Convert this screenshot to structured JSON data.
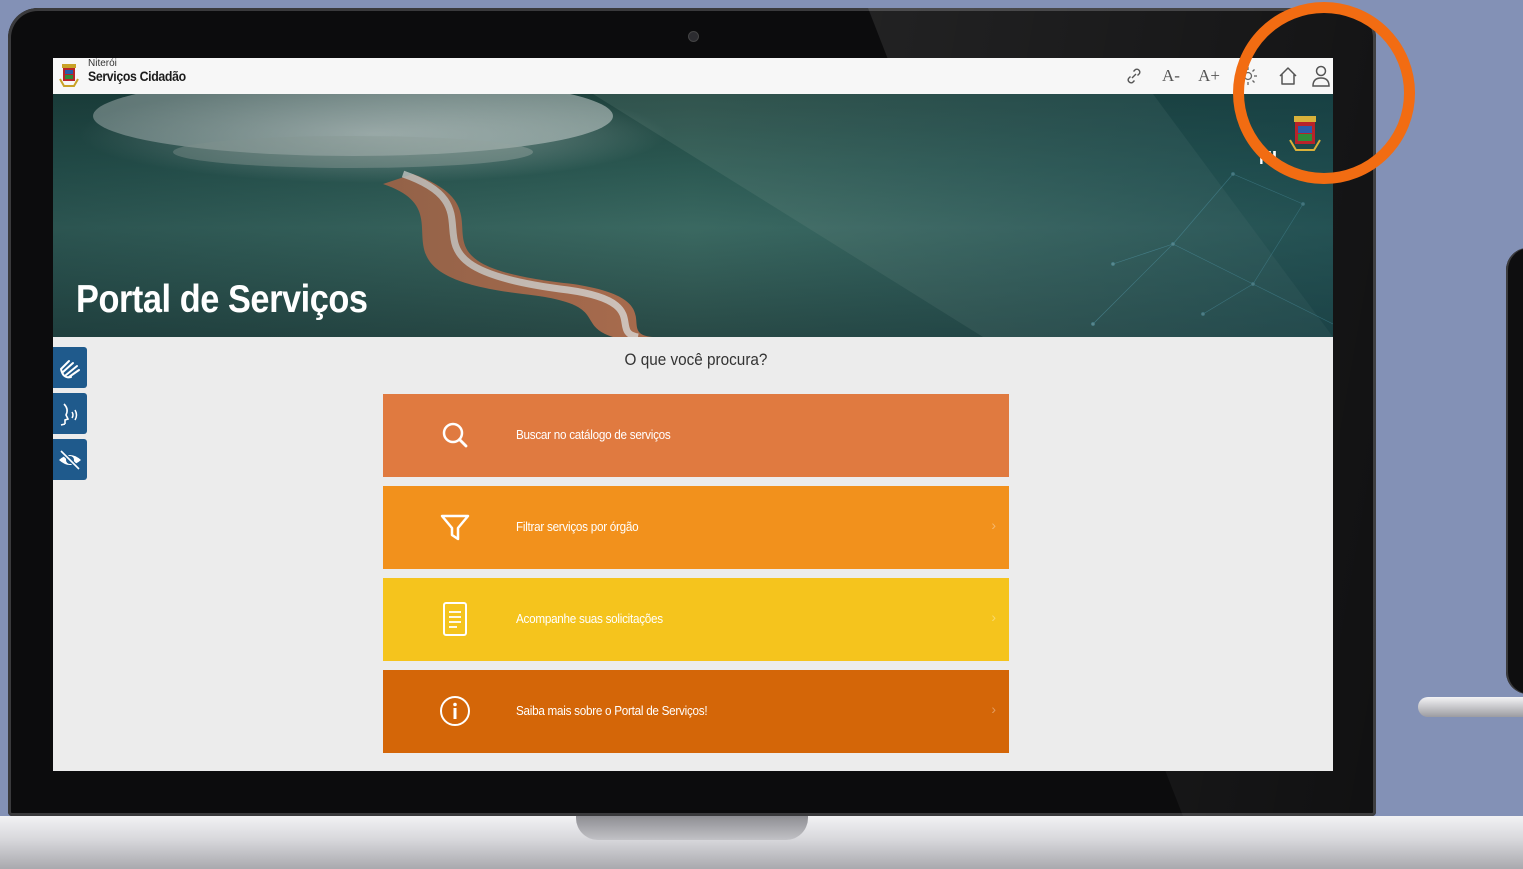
{
  "header": {
    "city": "Niterói",
    "app_name": "Serviços Cidadão",
    "tools": [
      {
        "name": "link-icon",
        "label": ""
      },
      {
        "name": "decrease-font",
        "label": "A-"
      },
      {
        "name": "increase-font",
        "label": "A+"
      },
      {
        "name": "contrast-icon",
        "label": ""
      },
      {
        "name": "home-icon",
        "label": ""
      },
      {
        "name": "user-icon",
        "label": ""
      }
    ]
  },
  "hero": {
    "title": "Portal de Serviços",
    "logo_text": "NI"
  },
  "accessibility": [
    {
      "name": "sign-language-icon"
    },
    {
      "name": "voice-reader-icon"
    },
    {
      "name": "high-contrast-icon"
    }
  ],
  "main": {
    "question": "O que você procura?",
    "items": [
      {
        "label": "Buscar no catálogo de serviços",
        "icon": "search-icon",
        "color": "#e07a40",
        "chevron": ""
      },
      {
        "label": "Filtrar serviços por órgão",
        "icon": "filter-icon",
        "color": "#f2911c",
        "chevron": "›"
      },
      {
        "label": "Acompanhe suas solicitações",
        "icon": "document-icon",
        "color": "#f5c41d",
        "chevron": "›"
      },
      {
        "label": "Saiba mais sobre o Portal de Serviços!",
        "icon": "info-icon",
        "color": "#d46608",
        "chevron": "›"
      }
    ]
  },
  "colors": {
    "background": "#8391b6",
    "highlight_ring": "#f26c12",
    "accessibility_blue": "#1f5a8c"
  }
}
